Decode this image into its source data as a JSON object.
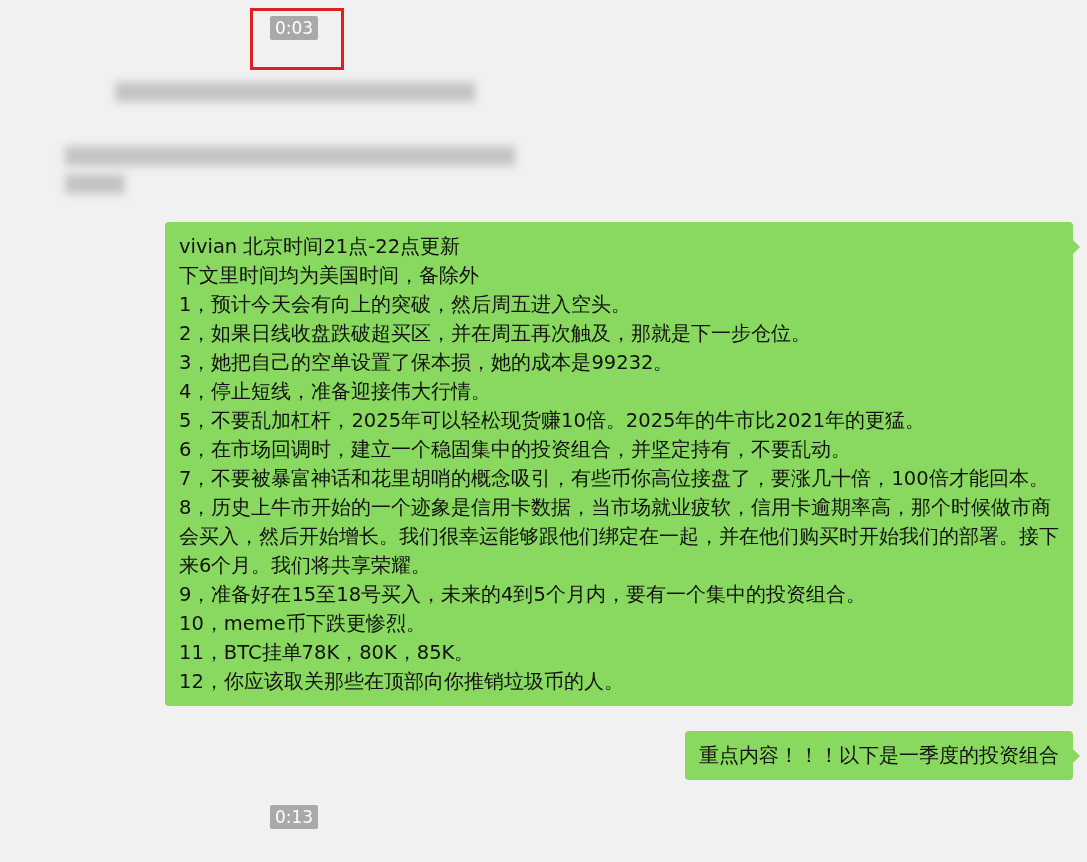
{
  "messages": [
    {
      "kind": "timestamp",
      "text": "0:03",
      "highlighted": true
    },
    {
      "kind": "blurred_line"
    },
    {
      "kind": "blurred_block"
    },
    {
      "kind": "bubble",
      "paragraphs": [
        "vivian 北京时间21点-22点更新",
        "下文里时间均为美国时间，备除外",
        "1，预计今天会有向上的突破，然后周五进入空头。",
        "2，如果日线收盘跌破超买区，并在周五再次触及，那就是下一步仓位。",
        "3，她把自己的空单设置了保本损，她的成本是99232。",
        "4，停止短线，准备迎接伟大行情。",
        "5，不要乱加杠杆，2025年可以轻松现货赚10倍。2025年的牛市比2021年的更猛。",
        "6，在市场回调时，建立一个稳固集中的投资组合，并坚定持有，不要乱动。",
        "7，不要被暴富神话和花里胡哨的概念吸引，有些币你高位接盘了，要涨几十倍，100倍才能回本。",
        "8，历史上牛市开始的一个迹象是信用卡数据，当市场就业疲软，信用卡逾期率高，那个时候做市商会买入，然后开始增长。我们很幸运能够跟他们绑定在一起，并在他们购买时开始我们的部署。接下来6个月。我们将共享荣耀。",
        "9，准备好在15至18号买入，未来的4到5个月内，要有一个集中的投资组合。",
        "10，meme币下跌更惨烈。",
        "11，BTC挂单78K，80K，85K。",
        "12，你应该取关那些在顶部向你推销垃圾币的人。"
      ]
    },
    {
      "kind": "bubble",
      "paragraphs": [
        "重点内容！！！以下是一季度的投资组合"
      ]
    },
    {
      "kind": "timestamp",
      "text": "0:13",
      "highlighted": false
    }
  ]
}
